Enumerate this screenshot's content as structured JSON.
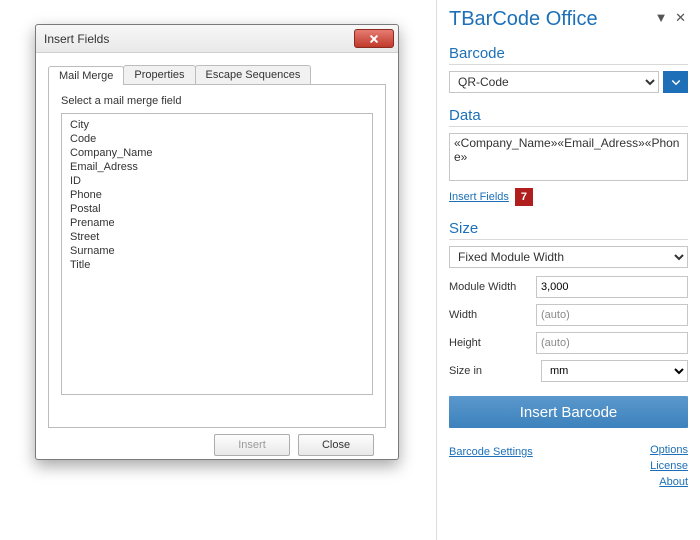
{
  "dialog": {
    "title": "Insert Fields",
    "tabs": [
      "Mail Merge",
      "Properties",
      "Escape Sequences"
    ],
    "active_tab": 0,
    "prompt": "Select a mail merge field",
    "fields": [
      "City",
      "Code",
      "Company_Name",
      "Email_Adress",
      "ID",
      "Phone",
      "Postal",
      "Prename",
      "Street",
      "Surname",
      "Title"
    ],
    "buttons": {
      "insert": "Insert",
      "close": "Close"
    }
  },
  "panel": {
    "title": "TBarCode Office",
    "sections": {
      "barcode": {
        "label": "Barcode",
        "selected": "QR-Code"
      },
      "data": {
        "label": "Data",
        "value": "«Company_Name»«Email_Adress»«Phone»",
        "insert_link": "Insert Fields",
        "badge": "7"
      },
      "size": {
        "label": "Size",
        "mode": "Fixed Module Width",
        "module_width": {
          "label": "Module Width",
          "value": "3,000"
        },
        "width": {
          "label": "Width",
          "value": "(auto)"
        },
        "height": {
          "label": "Height",
          "value": "(auto)"
        },
        "unit": {
          "label": "Size in",
          "value": "mm"
        }
      }
    },
    "insert_barcode": "Insert Barcode",
    "footer": {
      "settings": "Barcode Settings",
      "options": "Options",
      "license": "License",
      "about": "About"
    }
  }
}
